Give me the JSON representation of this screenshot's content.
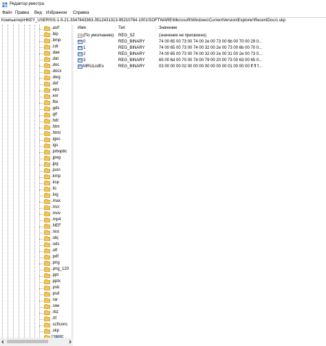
{
  "window": {
    "title": "Редактор реестра"
  },
  "menu": [
    "Файл",
    "Правка",
    "Вид",
    "Избранное",
    "Справка"
  ],
  "address": "Компьютер\\HKEY_USERS\\S-1-5-21-3347843363-3512431313-95210764-1001\\SOFTWARE\\Microsoft\\Windows\\CurrentVersion\\Explorer\\RecentDocs\\.skp",
  "tree": {
    "items": [
      ".avif",
      ".bip",
      ".bmp",
      ".cdr",
      ".dae",
      ".dat",
      ".doc",
      ".docx",
      ".dwg",
      ".dxf",
      ".eps",
      ".exr",
      ".fbx",
      ".gds",
      ".gif",
      ".hdr",
      ".htm",
      ".html",
      ".iges",
      ".igs",
      ".joboptic",
      ".jpeg",
      ".jpg",
      ".json",
      ".kmp",
      ".ksp",
      ".lic",
      ".log",
      ".max",
      ".mcr",
      ".mov",
      ".mp4",
      ".NEF",
      ".nist",
      ".obj",
      ".ods",
      ".otf",
      ".pdf",
      ".png",
      ".png_120",
      ".ppt",
      ".pptx",
      ".psb",
      ".psd",
      ".rar",
      ".raw",
      ".rbz",
      ".rtf",
      ".scficonc",
      ".skp",
      ".skp)"
    ],
    "selected_index": 50
  },
  "columns": {
    "name": "Имя",
    "type": "Тип",
    "data": "Значение"
  },
  "values": [
    {
      "name": "(По умолчанию)",
      "type": "REG_SZ",
      "data": "(значение не присвоено)",
      "kind": "sz"
    },
    {
      "name": "0",
      "type": "REG_BINARY",
      "data": "74 00 65 00 73 00 74 00 2e 00 73 00 6b 00 70 00 29 0...",
      "kind": "bin"
    },
    {
      "name": "1",
      "type": "REG_BINARY",
      "data": "74 00 65 00 73 00 74 00 32 00 2e 00 73 00 6b 00 70 0...",
      "kind": "bin"
    },
    {
      "name": "2",
      "type": "REG_BINARY",
      "data": "74 00 65 00 73 00 74 00 32 00 2e 00 31 00 2e 00 73 0...",
      "kind": "bin"
    },
    {
      "name": "3",
      "type": "REG_BINARY",
      "data": "65 00 6d 00 70 00 74 00 79 00 20 00 73 00 63 00 65 0...",
      "kind": "bin"
    },
    {
      "name": "MRUListEx",
      "type": "REG_BINARY",
      "data": "03 00 00 00 02 00 00 00 00 00 00 00 01 00 00 00 ff ff f...",
      "kind": "bin"
    }
  ]
}
